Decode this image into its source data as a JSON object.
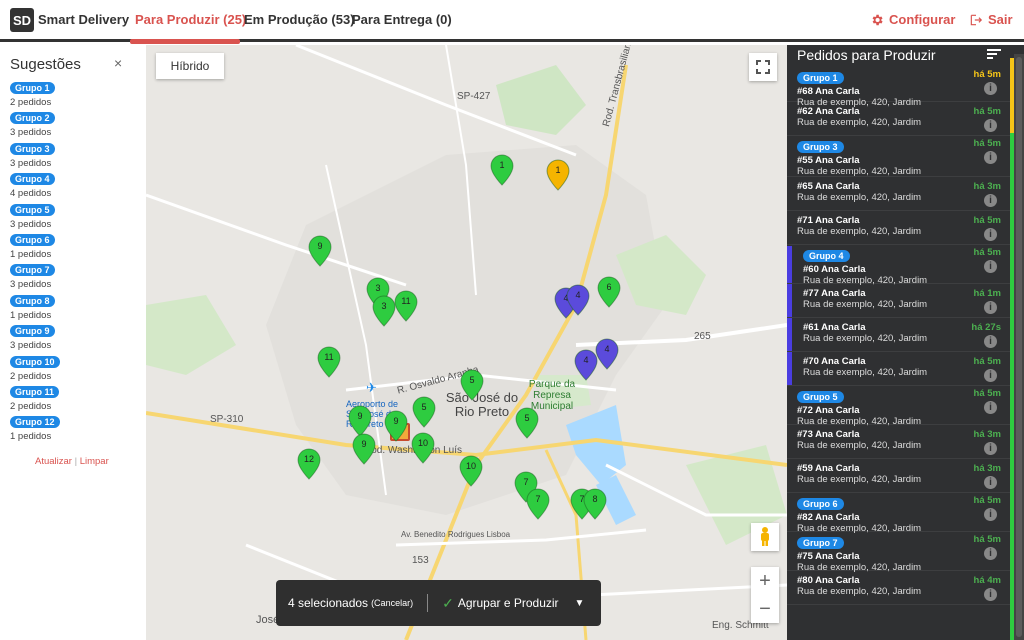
{
  "header": {
    "logo": "SD",
    "title": "Smart Delivery",
    "tabs": [
      "Para Produzir (25)",
      "Em Produção (53)",
      "Para Entrega (0)"
    ],
    "configure": "Configurar",
    "logout": "Sair"
  },
  "suggestions": {
    "title": "Sugestões",
    "close": "×",
    "groups": [
      {
        "label": "Grupo 1",
        "count": "2 pedidos"
      },
      {
        "label": "Grupo 2",
        "count": "3 pedidos"
      },
      {
        "label": "Grupo 3",
        "count": "3 pedidos"
      },
      {
        "label": "Grupo 4",
        "count": "4 pedidos"
      },
      {
        "label": "Grupo 5",
        "count": "3 pedidos"
      },
      {
        "label": "Grupo 6",
        "count": "1 pedidos"
      },
      {
        "label": "Grupo 7",
        "count": "3 pedidos"
      },
      {
        "label": "Grupo 8",
        "count": "1 pedidos"
      },
      {
        "label": "Grupo 9",
        "count": "3 pedidos"
      },
      {
        "label": "Grupo 10",
        "count": "2 pedidos"
      },
      {
        "label": "Grupo 11",
        "count": "2 pedidos"
      },
      {
        "label": "Grupo 12",
        "count": "1 pedidos"
      }
    ],
    "refresh": "Atualizar",
    "separator": "|",
    "clear": "Limpar"
  },
  "map": {
    "hybrid_button": "Híbrido",
    "city": "São José do Rio Preto",
    "zoom_in": "+",
    "zoom_out": "−",
    "labels": [
      {
        "text": "SP-427"
      },
      {
        "text": "SP-310"
      },
      {
        "text": "Rod. Transbrasiliana"
      },
      {
        "text": "R. Osvaldo Aranha"
      },
      {
        "text": "Rod. Washington Luís"
      },
      {
        "text": "Av. Benedito Rodrigues Lisboa"
      },
      {
        "text": "Eng. Schmitt"
      },
      {
        "text": "265"
      },
      {
        "text": "153"
      },
      {
        "text": "José"
      }
    ],
    "green_labels": [
      "Parque da Represa Municipal"
    ],
    "airport_label": "Aeroporto de São José do Rio Preto",
    "markers": [
      {
        "label": "1",
        "color": "#2ecc40"
      },
      {
        "label": "1",
        "color": "#f5b400"
      },
      {
        "label": "9",
        "color": "#2ecc40"
      },
      {
        "label": "3",
        "color": "#2ecc40"
      },
      {
        "label": "3",
        "color": "#2ecc40"
      },
      {
        "label": "11",
        "color": "#2ecc40"
      },
      {
        "label": "4",
        "color": "#5b4bdb"
      },
      {
        "label": "4",
        "color": "#5b4bdb"
      },
      {
        "label": "6",
        "color": "#2ecc40"
      },
      {
        "label": "4",
        "color": "#5b4bdb"
      },
      {
        "label": "4",
        "color": "#5b4bdb"
      },
      {
        "label": "11",
        "color": "#2ecc40"
      },
      {
        "label": "5",
        "color": "#2ecc40"
      },
      {
        "label": "5",
        "color": "#2ecc40"
      },
      {
        "label": "5",
        "color": "#2ecc40"
      },
      {
        "label": "9",
        "color": "#2ecc40"
      },
      {
        "label": "9",
        "color": "#2ecc40"
      },
      {
        "label": "9",
        "color": "#2ecc40"
      },
      {
        "label": "10",
        "color": "#2ecc40"
      },
      {
        "label": "12",
        "color": "#2ecc40"
      },
      {
        "label": "10",
        "color": "#2ecc40"
      },
      {
        "label": "7",
        "color": "#2ecc40"
      },
      {
        "label": "7",
        "color": "#2ecc40"
      },
      {
        "label": "7",
        "color": "#2ecc40"
      },
      {
        "label": "8",
        "color": "#2ecc40"
      }
    ]
  },
  "action_bar": {
    "count": "4 selecionados",
    "cancel": "(Cancelar)",
    "group_produce": "Agrupar e Produzir"
  },
  "orders_panel": {
    "title": "Pedidos para Produzir",
    "orders": [
      {
        "group": "Grupo 1",
        "num": "#68 Ana Carla",
        "addr": "Rua de exemplo, 420, Jardim",
        "time": "há 5m",
        "time_color": "yellow",
        "selected": false
      },
      {
        "group": "",
        "num": "#62 Ana Carla",
        "addr": "Rua de exemplo, 420, Jardim",
        "time": "há 5m",
        "time_color": "green",
        "selected": false
      },
      {
        "group": "Grupo 3",
        "num": "#55 Ana Carla",
        "addr": "Rua de exemplo, 420, Jardim",
        "time": "há 5m",
        "time_color": "green",
        "selected": false
      },
      {
        "group": "",
        "num": "#65 Ana Carla",
        "addr": "Rua de exemplo, 420, Jardim",
        "time": "há 3m",
        "time_color": "green",
        "selected": false
      },
      {
        "group": "",
        "num": "#71 Ana Carla",
        "addr": "Rua de exemplo, 420, Jardim",
        "time": "há 5m",
        "time_color": "green",
        "selected": false
      },
      {
        "group": "Grupo 4",
        "num": "#60 Ana Carla",
        "addr": "Rua de exemplo, 420, Jardim",
        "time": "há 5m",
        "time_color": "green",
        "selected": true
      },
      {
        "group": "",
        "num": "#77 Ana Carla",
        "addr": "Rua de exemplo, 420, Jardim",
        "time": "há 1m",
        "time_color": "green",
        "selected": true
      },
      {
        "group": "",
        "num": "#61 Ana Carla",
        "addr": "Rua de exemplo, 420, Jardim",
        "time": "há 27s",
        "time_color": "green",
        "selected": true
      },
      {
        "group": "",
        "num": "#70 Ana Carla",
        "addr": "Rua de exemplo, 420, Jardim",
        "time": "há 5m",
        "time_color": "green",
        "selected": true
      },
      {
        "group": "Grupo 5",
        "num": "#72 Ana Carla",
        "addr": "Rua de exemplo, 420, Jardim",
        "time": "há 5m",
        "time_color": "green",
        "selected": false
      },
      {
        "group": "",
        "num": "#73 Ana Carla",
        "addr": "Rua de exemplo, 420, Jardim",
        "time": "há 3m",
        "time_color": "green",
        "selected": false
      },
      {
        "group": "",
        "num": "#59 Ana Carla",
        "addr": "Rua de exemplo, 420, Jardim",
        "time": "há 3m",
        "time_color": "green",
        "selected": false
      },
      {
        "group": "Grupo 6",
        "num": "#82 Ana Carla",
        "addr": "Rua de exemplo, 420, Jardim",
        "time": "há 5m",
        "time_color": "green",
        "selected": false
      },
      {
        "group": "Grupo 7",
        "num": "#75 Ana Carla",
        "addr": "Rua de exemplo, 420, Jardim",
        "time": "há 5m",
        "time_color": "green",
        "selected": false
      },
      {
        "group": "",
        "num": "#80 Ana Carla",
        "addr": "Rua de exemplo, 420, Jardim",
        "time": "há 4m",
        "time_color": "green",
        "selected": false
      }
    ]
  },
  "colors": {
    "accent_red": "#d9534f",
    "group_blue": "#1e88e5",
    "marker_green": "#2ecc40",
    "marker_yellow": "#f5b400",
    "marker_purple": "#5b4bdb",
    "panel_dark": "#2f3032"
  }
}
